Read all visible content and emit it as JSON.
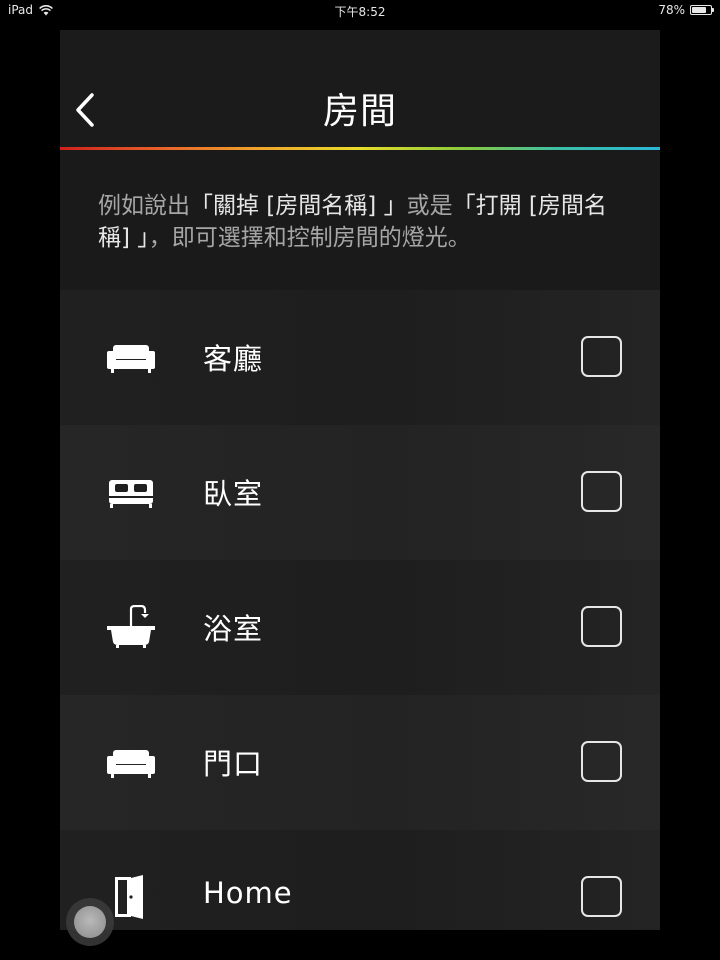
{
  "status_bar": {
    "device": "iPad",
    "time": "下午8:52",
    "battery_text": "78%",
    "battery_level": 0.78
  },
  "header": {
    "title": "房間",
    "back_icon": "chevron-left-icon"
  },
  "hint": {
    "part1": "例如說出",
    "quote1": "「關掉 [房間名稱] 」",
    "part2": "或是",
    "quote2": "「打開 [房間名稱] 」",
    "part3": "，即可選擇和控制房間的燈光。"
  },
  "rooms": [
    {
      "label": "客廳",
      "icon": "sofa-icon",
      "checked": false
    },
    {
      "label": "臥室",
      "icon": "bed-icon",
      "checked": false
    },
    {
      "label": "浴室",
      "icon": "bathtub-icon",
      "checked": false
    },
    {
      "label": "門口",
      "icon": "sofa-icon",
      "checked": false
    },
    {
      "label": "Home",
      "icon": "door-icon",
      "checked": false
    }
  ],
  "colors": {
    "background": "#000000",
    "panel": "#1a1a1a",
    "accent_gradient": [
      "#d0211c",
      "#f0a52b",
      "#e9dc2a",
      "#8ccc3c",
      "#2ab8d8"
    ]
  }
}
